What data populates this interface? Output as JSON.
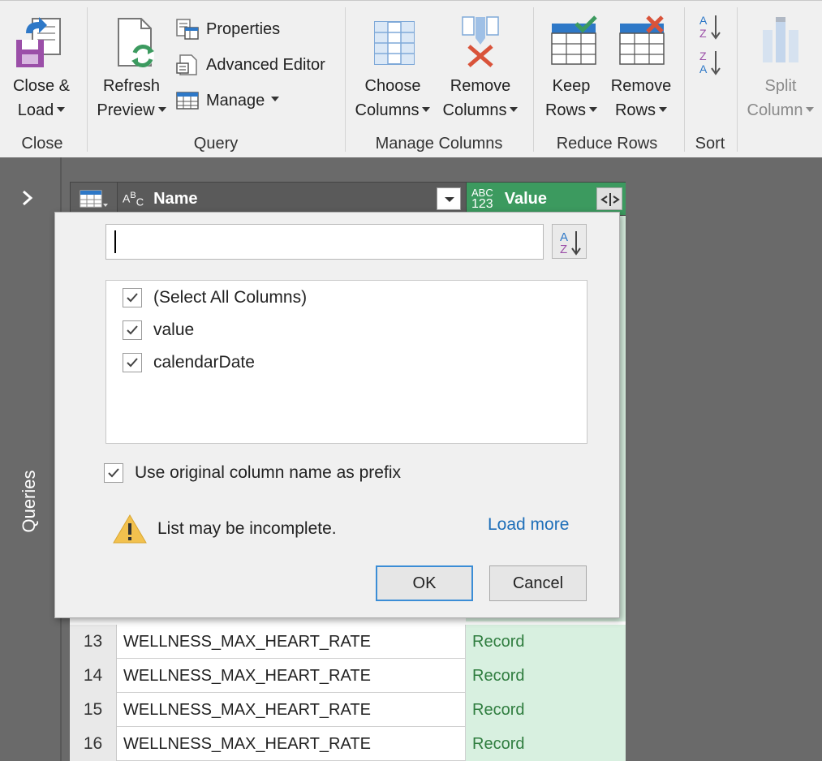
{
  "ribbon": {
    "groups": {
      "close": "Close",
      "query": "Query",
      "manage_columns": "Manage Columns",
      "reduce_rows": "Reduce Rows",
      "sort": "Sort"
    },
    "close_load": {
      "line1": "Close &",
      "line2": "Load"
    },
    "refresh_preview": {
      "line1": "Refresh",
      "line2": "Preview"
    },
    "properties": "Properties",
    "advanced_editor": "Advanced Editor",
    "manage": "Manage",
    "choose_columns": {
      "line1": "Choose",
      "line2": "Columns"
    },
    "remove_columns": {
      "line1": "Remove",
      "line2": "Columns"
    },
    "keep_rows": {
      "line1": "Keep",
      "line2": "Rows"
    },
    "remove_rows": {
      "line1": "Remove",
      "line2": "Rows"
    },
    "split_column": {
      "line1": "Split",
      "line2": "Column"
    }
  },
  "queries_pane": {
    "label": "Queries"
  },
  "grid": {
    "columns": {
      "name": {
        "type_top": "A",
        "type_sup": "B",
        "type_sub": "C",
        "label": "Name"
      },
      "value": {
        "type_top": "ABC",
        "type_bottom": "123",
        "label": "Value"
      }
    },
    "rows": [
      {
        "num": "13",
        "name": "WELLNESS_MAX_HEART_RATE",
        "value": "Record"
      },
      {
        "num": "14",
        "name": "WELLNESS_MAX_HEART_RATE",
        "value": "Record"
      },
      {
        "num": "15",
        "name": "WELLNESS_MAX_HEART_RATE",
        "value": "Record"
      },
      {
        "num": "16",
        "name": "WELLNESS_MAX_HEART_RATE",
        "value": "Record"
      }
    ]
  },
  "popup": {
    "search": {
      "value": "",
      "placeholder": ""
    },
    "columns": [
      {
        "label": "(Select All Columns)",
        "checked": true
      },
      {
        "label": "value",
        "checked": true
      },
      {
        "label": "calendarDate",
        "checked": true
      }
    ],
    "prefix_label": "Use original column name as prefix",
    "prefix_checked": true,
    "warning": "List may be incomplete.",
    "load_more": "Load more",
    "ok": "OK",
    "cancel": "Cancel"
  },
  "colors": {
    "accent_green": "#3c9a5f",
    "link_blue": "#1e6fb9",
    "warning_yellow": "#f2c14e"
  }
}
